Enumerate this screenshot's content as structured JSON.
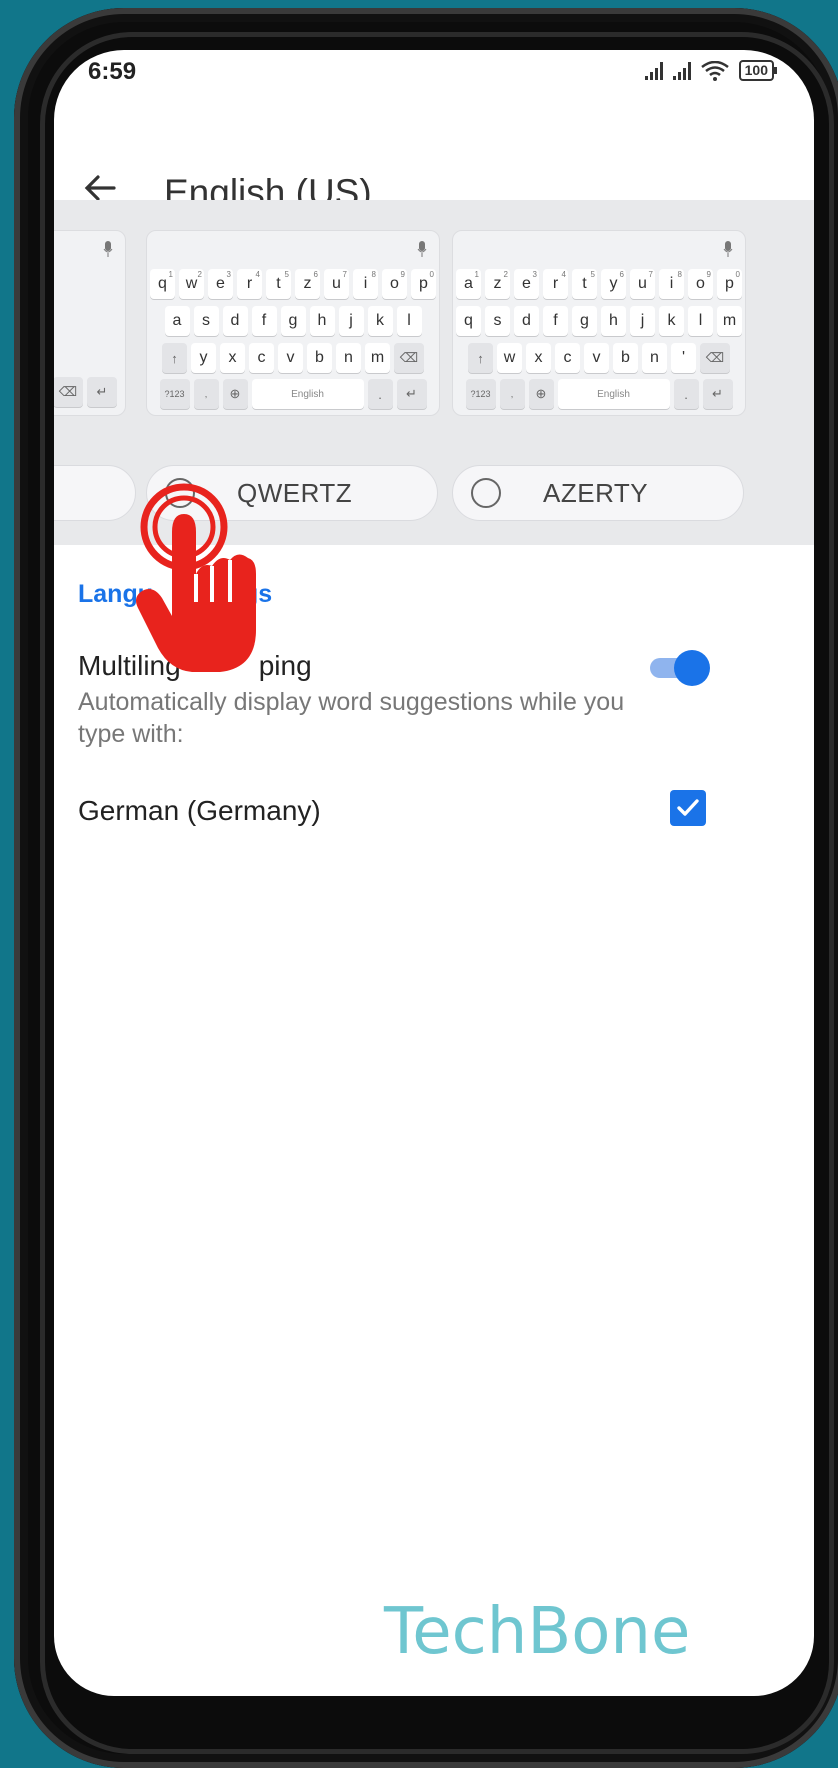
{
  "status_bar": {
    "time": "6:59",
    "battery": "100"
  },
  "app_bar": {
    "title": "English (US)"
  },
  "keyboards": {
    "qwertz": {
      "row1": [
        "q",
        "w",
        "e",
        "r",
        "t",
        "z",
        "u",
        "i",
        "o",
        "p"
      ],
      "row1_nums": [
        "1",
        "2",
        "3",
        "4",
        "5",
        "6",
        "7",
        "8",
        "9",
        "0"
      ],
      "row2": [
        "a",
        "s",
        "d",
        "f",
        "g",
        "h",
        "j",
        "k",
        "l"
      ],
      "row3": [
        "y",
        "x",
        "c",
        "v",
        "b",
        "n",
        "m"
      ],
      "symbols_key": "?123",
      "space_label": "English",
      "period": "."
    },
    "azerty": {
      "row1": [
        "a",
        "z",
        "e",
        "r",
        "t",
        "y",
        "u",
        "i",
        "o",
        "p"
      ],
      "row1_nums": [
        "1",
        "2",
        "3",
        "4",
        "5",
        "6",
        "7",
        "8",
        "9",
        "0"
      ],
      "row2": [
        "q",
        "s",
        "d",
        "f",
        "g",
        "h",
        "j",
        "k",
        "l",
        "m"
      ],
      "row3": [
        "w",
        "x",
        "c",
        "v",
        "b",
        "n",
        "'"
      ],
      "symbols_key": "?123",
      "space_label": "English",
      "period": "."
    }
  },
  "layout_options": [
    {
      "label": "QWERTZ",
      "selected": false
    },
    {
      "label": "AZERTY",
      "selected": false
    }
  ],
  "section": {
    "title": "Langu",
    "title_tail": "gs"
  },
  "multilingual": {
    "title_start": "Multiling",
    "title_end": "ping",
    "description": "Automatically display word suggestions while you type with:",
    "enabled": true
  },
  "languages": [
    {
      "label": "German (Germany)",
      "checked": true
    }
  ],
  "watermark": "TechBone",
  "colors": {
    "accent": "#1a73e8",
    "background": "#11768a",
    "hand": "#e8231d"
  }
}
